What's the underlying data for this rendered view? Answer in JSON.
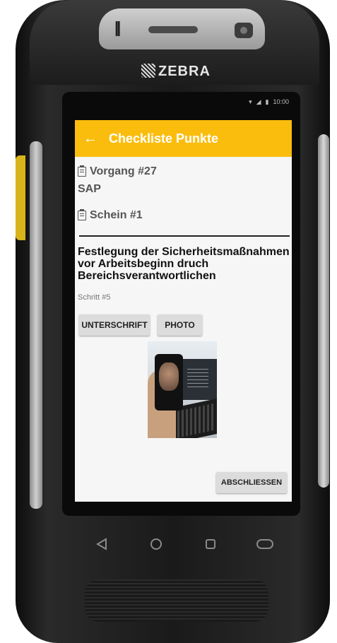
{
  "device": {
    "brand": "ZEBRA",
    "status_time": "10:00"
  },
  "appbar": {
    "back_icon": "arrow-left-icon",
    "title": "Checkliste Punkte"
  },
  "info": {
    "vorgang": "Vorgang #27",
    "system": "SAP",
    "schein": "Schein #1"
  },
  "step": {
    "title": "Festlegung der Sicherheitsmaßnahmen vor Arbeitsbeginn druch Bereichsverantwortlichen",
    "subtitle": "Schritt #5"
  },
  "buttons": {
    "signature": "UNTERSCHRIFT",
    "photo": "PHOTO",
    "finish": "ABSCHLIESSEN"
  },
  "colors": {
    "accent": "#fbbd0d",
    "screen_bg": "#f6f6f6",
    "button_bg": "#dcdcdc"
  }
}
